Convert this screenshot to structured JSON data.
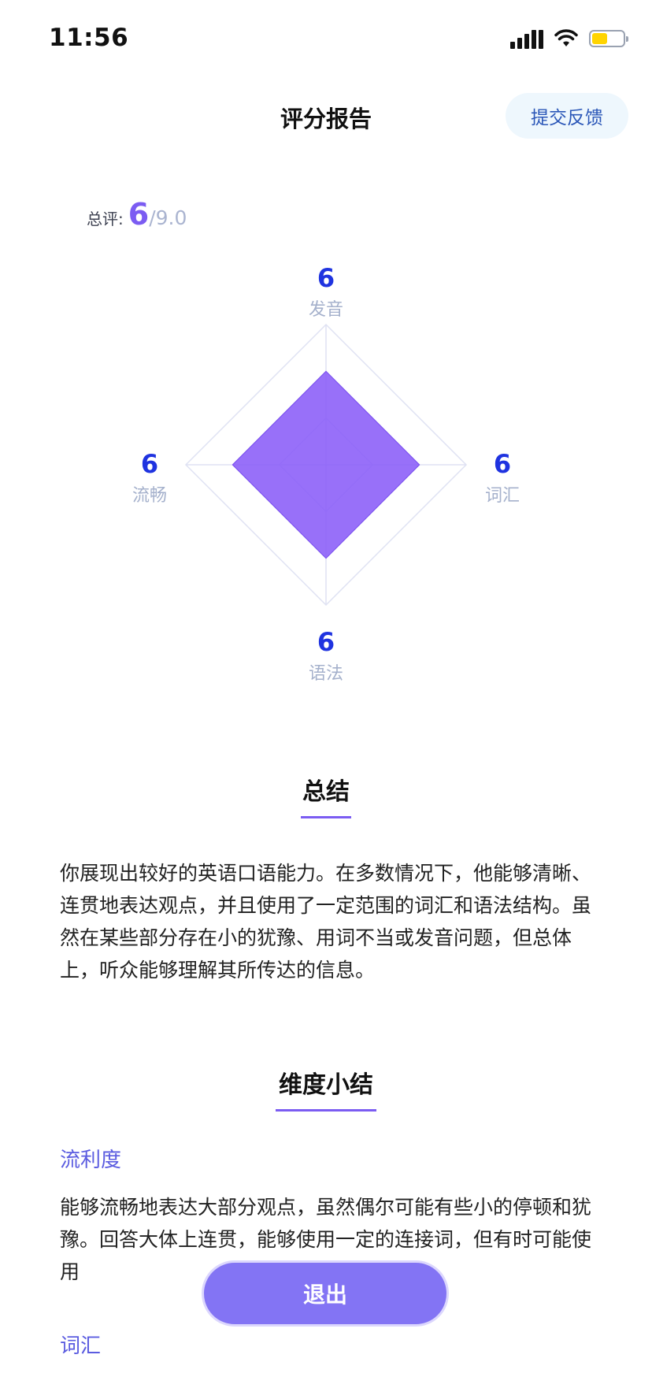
{
  "status_bar": {
    "time": "11:56"
  },
  "header": {
    "title": "评分报告",
    "feedback_label": "提交反馈"
  },
  "overall": {
    "label": "总评:",
    "score": "6",
    "max": "/9.0"
  },
  "radar": {
    "max": 9,
    "levels": [
      3,
      6,
      9
    ],
    "fill_color": "#8a5cf8",
    "dimensions": [
      {
        "label": "发音",
        "score": 6
      },
      {
        "label": "词汇",
        "score": 6
      },
      {
        "label": "语法",
        "score": 6
      },
      {
        "label": "流畅",
        "score": 6
      }
    ]
  },
  "summary": {
    "title": "总结",
    "text": "你展现出较好的英语口语能力。在多数情况下，他能够清晰、连贯地表达观点，并且使用了一定范围的词汇和语法结构。虽然在某些部分存在小的犹豫、用词不当或发音问题，但总体上，听众能够理解其所传达的信息。"
  },
  "dimension_summary": {
    "title": "维度小结",
    "items": [
      {
        "title": "流利度",
        "text": "能够流畅地表达大部分观点，虽然偶尔可能有些小的停顿和犹豫。回答大体上连贯，能够使用一定的连接词，但有时可能使用"
      },
      {
        "title": "词汇"
      }
    ]
  },
  "exit_label": "退出"
}
